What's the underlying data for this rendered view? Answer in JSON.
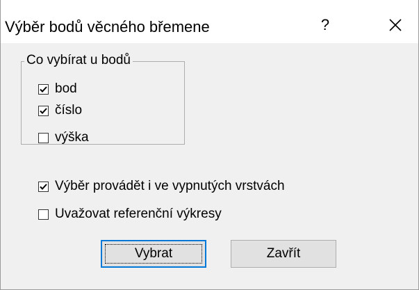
{
  "window": {
    "title": "Výběr bodů věcného břemene",
    "help_label": "?",
    "close_icon": "close-icon"
  },
  "group": {
    "legend": "Co vybírat u bodů",
    "options": [
      {
        "label": "bod",
        "checked": true
      },
      {
        "label": "číslo",
        "checked": true
      },
      {
        "label": "výška",
        "checked": false
      }
    ]
  },
  "options": [
    {
      "label": "Výběr provádět i ve vypnutých vrstvách",
      "checked": true
    },
    {
      "label": "Uvažovat referenční výkresy",
      "checked": false
    }
  ],
  "buttons": {
    "select_label": "Vybrat",
    "close_label": "Zavřít"
  },
  "colors": {
    "accent": "#0078d7",
    "dialog_bg": "#f0f0f0"
  }
}
